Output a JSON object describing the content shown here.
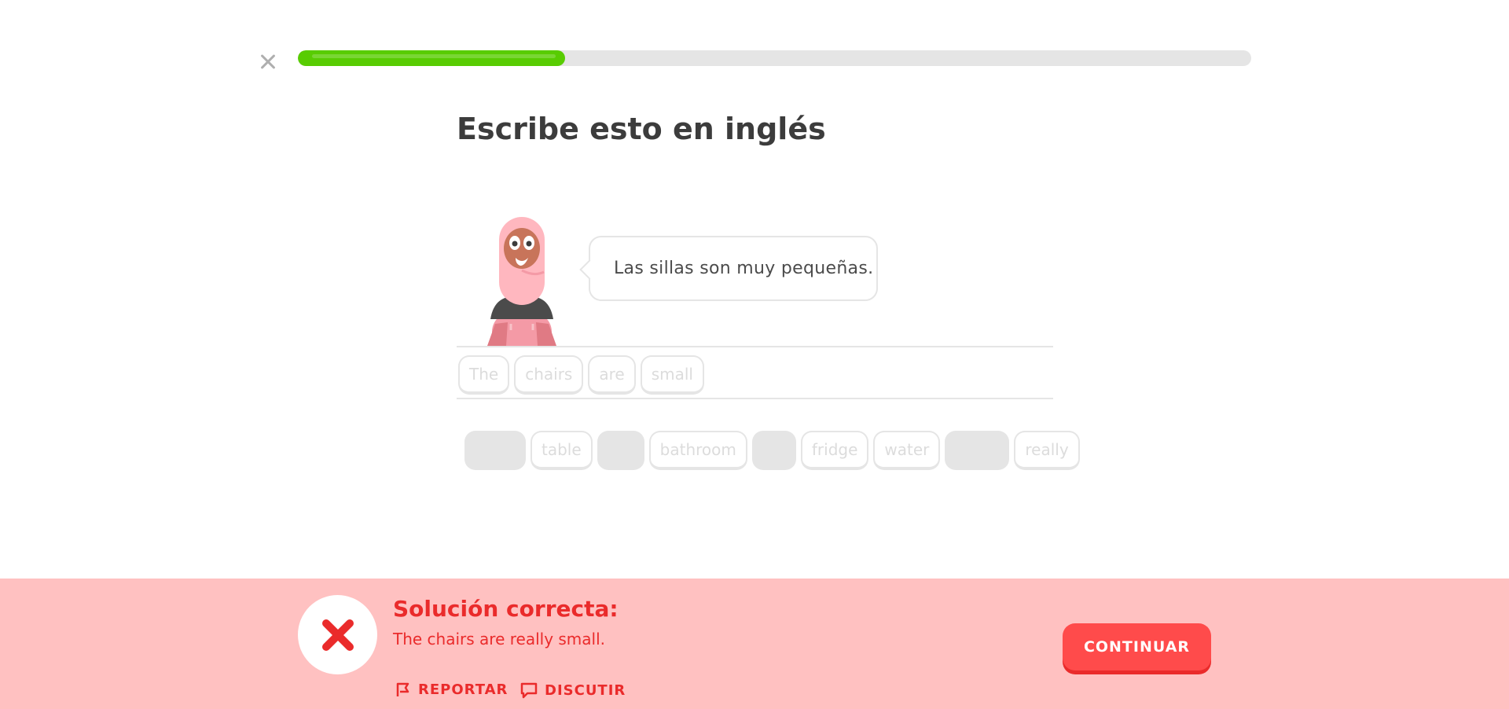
{
  "progress": {
    "percent": 28
  },
  "header": {
    "title": "Escribe esto en inglés"
  },
  "prompt": {
    "sentence": "Las sillas son muy pequeñas."
  },
  "answer": {
    "words": [
      "The",
      "chairs",
      "are",
      "small"
    ]
  },
  "word_bank": [
    {
      "type": "slot"
    },
    {
      "type": "word",
      "label": "table"
    },
    {
      "type": "slot"
    },
    {
      "type": "word",
      "label": "bathroom"
    },
    {
      "type": "slot"
    },
    {
      "type": "word",
      "label": "fridge"
    },
    {
      "type": "word",
      "label": "water"
    },
    {
      "type": "slot"
    },
    {
      "type": "word",
      "label": "really"
    }
  ],
  "feedback": {
    "heading": "Solución correcta:",
    "solution": "The chairs are really small.",
    "report_label": "REPORTAR",
    "discuss_label": "DISCUTIR",
    "continue_label": "CONTINUAR"
  },
  "colors": {
    "accent_green": "#58cc02",
    "error_red": "#ea2b2b",
    "error_bg": "#ffc1c1",
    "button_red": "#ff4b4b"
  },
  "icons": {
    "close": "close-icon",
    "wrong": "x-mark-icon",
    "report": "flag-icon",
    "discuss": "chat-bubble-icon"
  }
}
